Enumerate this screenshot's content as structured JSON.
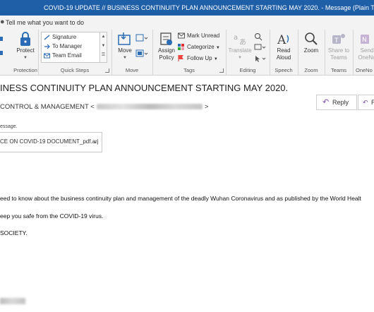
{
  "window": {
    "title": "COVID-19 UPDATE // BUSINESS CONTINUITY PLAN ANNOUNCEMENT STARTING MAY 2020.  -  Message (Plain Text)"
  },
  "tellme": {
    "placeholder": "Tell me what you want to do"
  },
  "ribbon": {
    "protection": {
      "protect_label": "Protect",
      "group_label": "Protection"
    },
    "quick_steps": {
      "items": [
        "Signature",
        "To Manager",
        "Team Email"
      ],
      "group_label": "Quick Steps"
    },
    "move": {
      "move_label": "Move",
      "group_label": "Move"
    },
    "tags": {
      "assign_policy_label": "Assign\nPolicy",
      "mark_unread": "Mark Unread",
      "categorize": "Categorize",
      "follow_up": "Follow Up",
      "group_label": "Tags"
    },
    "editing": {
      "translate_label": "Translate",
      "group_label": "Editing"
    },
    "speech": {
      "read_aloud_label": "Read\nAloud",
      "group_label": "Speech"
    },
    "zoom": {
      "zoom_label": "Zoom",
      "group_label": "Zoom"
    },
    "teams": {
      "share_label": "Share to\nTeams",
      "group_label": "Teams"
    },
    "onenote": {
      "send_label": "Send\nOneNo",
      "group_label": "OneNo"
    }
  },
  "message": {
    "subject": "INESS CONTINUITY PLAN ANNOUNCEMENT STARTING MAY 2020.",
    "from": "CONTROL & MANAGEMENT <",
    "from_end": ">",
    "reply_label": "Reply",
    "notice": "essage.",
    "attachment_name": "CE ON COVID-19 DOCUMENT_pdf.arj",
    "body": [
      "eed to know about the business continuity plan and management of the deadly Wuhan Coronavirus and as published by the World Healt",
      "eep you safe from the COVID-19 virus.",
      "SOCIETY."
    ]
  },
  "colors": {
    "title_bar": "#1f5fa8",
    "ribbon_bg": "#f3f3f3",
    "accent_purple": "#7a4fa0",
    "icon_blue": "#2b6cb5"
  }
}
